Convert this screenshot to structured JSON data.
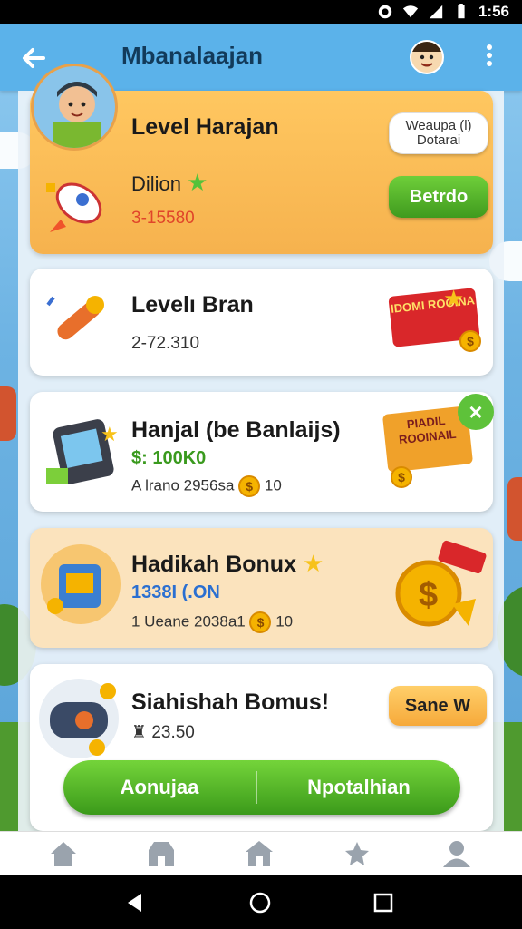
{
  "status_bar": {
    "time": "1:56"
  },
  "header": {
    "title": "Mbanalaajan"
  },
  "cards": [
    {
      "title": "Level Harajan",
      "subtitle": "Dilion",
      "value": "3-15580",
      "top_button": "Weaupa (l) Dotarai",
      "action_button": "Betrdo"
    },
    {
      "title": "Levelı Bran",
      "value": "2-72.310",
      "badge": "IDOMI ROOINA"
    },
    {
      "title": "Hanjal (be Banlaijs)",
      "highlight": "$: 100K0",
      "meta": "A lrano 2956sa",
      "meta_suffix": "10",
      "badge": "PIADIL ROOINAIL"
    },
    {
      "title": "Hadikah Bonux",
      "highlight": "1338I (.ON",
      "meta": "1 Ueane 2038a1",
      "meta_suffix": "10"
    },
    {
      "title": "Siahishah Bomus!",
      "value": "23.50",
      "action_button": "Sane W"
    }
  ],
  "actions": {
    "left": "Aonujaa",
    "right": "Npotalhian"
  },
  "colors": {
    "appbar": "#5bb2ea",
    "accent_green": "#4caf25",
    "card_orange": "#f6b24e",
    "card_peach": "#fbe3bd"
  },
  "nav": {
    "items": [
      "home-icon",
      "store-icon",
      "house-icon",
      "trophy-icon",
      "profile-icon"
    ]
  }
}
